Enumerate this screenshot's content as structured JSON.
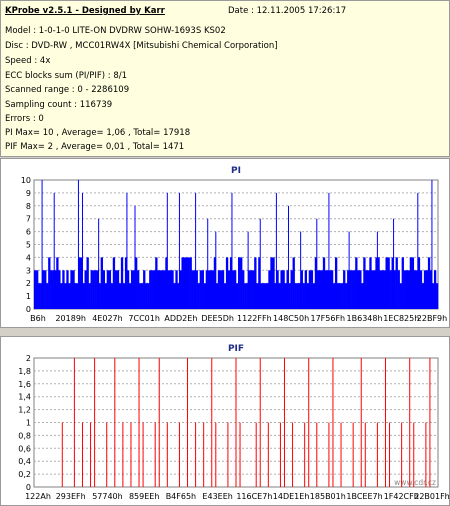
{
  "info": {
    "title": "KProbe v2.5.1 - Designed by Karr",
    "date": "Date : 12.11.2005 17:26:17",
    "lines": [
      "Model : 1-0-1-0 LITE-ON DVDRW SOHW-1693S KS02",
      "Disc : DVD-RW , MCC01RW4X [Mitsubishi Chemical Corporation]",
      "Speed : 4x",
      "ECC blocks sum (PI/PIF) : 8/1",
      "Scanned range : 0 - 2286109",
      "Sampling count : 116739",
      "Errors : 0",
      "PI Max= 10 , Average= 1,06 , Total= 17918",
      "PIF Max= 2 , Average= 0,01 , Total= 1471"
    ]
  },
  "watermark": "www.cdr.cz",
  "chart_data": [
    {
      "type": "bar",
      "title": "PI",
      "color": "#0000ff",
      "ylim": [
        0,
        10
      ],
      "yticks": [
        "0",
        "1",
        "2",
        "3",
        "4",
        "5",
        "6",
        "7",
        "8",
        "9",
        "10"
      ],
      "xticks": [
        "B6h",
        "20189h",
        "4E027h",
        "7CC01h",
        "ADD2Eh",
        "DEE5Dh",
        "1122FFh",
        "148C50h",
        "17F56Fh",
        "1B6348h",
        "1EC825h",
        "22BF9h"
      ],
      "baseline": 4,
      "baseline_range": [
        2,
        4
      ],
      "spikes": [
        [
          0.02,
          10
        ],
        [
          0.05,
          9
        ],
        [
          0.11,
          10
        ],
        [
          0.12,
          9
        ],
        [
          0.16,
          7
        ],
        [
          0.23,
          9
        ],
        [
          0.25,
          8
        ],
        [
          0.33,
          9
        ],
        [
          0.36,
          9
        ],
        [
          0.4,
          9
        ],
        [
          0.43,
          7
        ],
        [
          0.45,
          6
        ],
        [
          0.49,
          9
        ],
        [
          0.53,
          6
        ],
        [
          0.56,
          7
        ],
        [
          0.6,
          9
        ],
        [
          0.63,
          8
        ],
        [
          0.66,
          6
        ],
        [
          0.7,
          7
        ],
        [
          0.73,
          9
        ],
        [
          0.78,
          6
        ],
        [
          0.85,
          6
        ],
        [
          0.89,
          7
        ],
        [
          0.95,
          9
        ],
        [
          0.985,
          10
        ]
      ],
      "grid": true
    },
    {
      "type": "bar",
      "title": "PIF",
      "color": "#ff0000",
      "ylim": [
        0,
        2
      ],
      "yticks": [
        "0",
        "0,2",
        "0,4",
        "0,6",
        "0,8",
        "1",
        "1,2",
        "1,4",
        "1,6",
        "1,8",
        "2"
      ],
      "xticks": [
        "122Ah",
        "293EFh",
        "57740h",
        "859EEh",
        "B4F65h",
        "E43EEh",
        "116CE7h",
        "14DE1Eh",
        "185B01h",
        "1BCEE7h",
        "1F42CFh",
        "22B01Fh"
      ],
      "spikes_at_1": [
        0.07,
        0.12,
        0.14,
        0.18,
        0.22,
        0.24,
        0.27,
        0.3,
        0.33,
        0.36,
        0.4,
        0.42,
        0.45,
        0.48,
        0.51,
        0.55,
        0.58,
        0.61,
        0.64,
        0.67,
        0.7,
        0.73,
        0.76,
        0.79,
        0.82,
        0.85,
        0.88,
        0.91,
        0.94,
        0.97
      ],
      "spikes_at_2": [
        0.1,
        0.15,
        0.2,
        0.26,
        0.31,
        0.38,
        0.44,
        0.5,
        0.56,
        0.62,
        0.68,
        0.74,
        0.81,
        0.87,
        0.93,
        0.98
      ],
      "grid": true
    }
  ]
}
